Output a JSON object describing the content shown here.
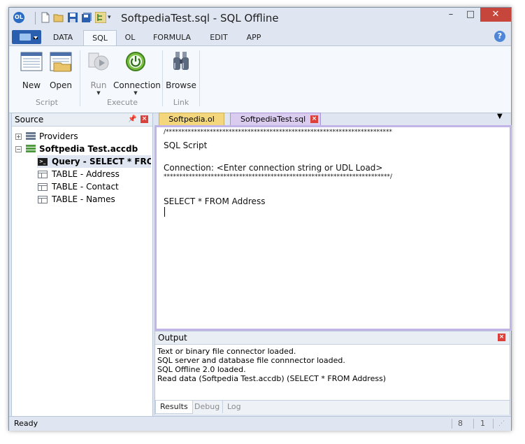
{
  "window": {
    "title": "Softpedia​Test.sql - SQL Offline",
    "controls": {
      "minimize": "–",
      "maximize": "□",
      "close": "✕"
    }
  },
  "quick_access": [
    "new-file-icon",
    "open-folder-icon",
    "save-icon",
    "save-all-icon",
    "tree-icon",
    "dropdown-icon"
  ],
  "ribbon": {
    "tabs": [
      {
        "label": "DATA"
      },
      {
        "label": "SQL"
      },
      {
        "label": "OL"
      },
      {
        "label": "FORMULA"
      },
      {
        "label": "EDIT"
      },
      {
        "label": "APP"
      }
    ],
    "active_tab": "SQL",
    "groups": {
      "script": {
        "label": "Script",
        "new_label": "New",
        "open_label": "Open"
      },
      "execute": {
        "label": "Execute",
        "run_label": "Run",
        "connection_label": "Connection"
      },
      "link": {
        "label": "Link",
        "browse_label": "Browse"
      }
    }
  },
  "source": {
    "title": "Source",
    "tree": {
      "providers": "Providers",
      "database": "Softpedia Test.accdb",
      "items": [
        {
          "label": "Query - SELECT * FROM A",
          "icon": "query-icon",
          "selected": true
        },
        {
          "label": "TABLE - Address",
          "icon": "table-icon"
        },
        {
          "label": "TABLE - Contact",
          "icon": "table-icon"
        },
        {
          "label": "TABLE - Names",
          "icon": "table-icon"
        }
      ]
    }
  },
  "editor": {
    "tabs": [
      {
        "label": "Softpedia.ol"
      },
      {
        "label": "SoftpediaTest.sql"
      }
    ],
    "active_tab": "SoftpediaTest.sql",
    "lines": [
      "/************************************************************************",
      "SQL Script",
      "Connection: <Enter connection string or UDL Load>",
      "************************************************************************/",
      "SELECT * FROM Address"
    ]
  },
  "output": {
    "title": "Output",
    "lines": [
      "Text or binary file connector loaded.",
      "SQL server and database file connnector loaded.",
      "SQL Offline 2.0 loaded.",
      "Read data (Softpedia Test.accdb) (SELECT * FROM Address)"
    ],
    "tabs": [
      {
        "label": "Results"
      },
      {
        "label": "Debug"
      },
      {
        "label": "Log"
      }
    ],
    "active_tab": "Results"
  },
  "status": {
    "text": "Ready",
    "line": "8",
    "column": "1"
  },
  "colors": {
    "accent": "#2a5fb0",
    "editor_border": "#c1b4e6",
    "inactive_doc_tab": "#f4d77c",
    "close_red": "#d9413a"
  }
}
